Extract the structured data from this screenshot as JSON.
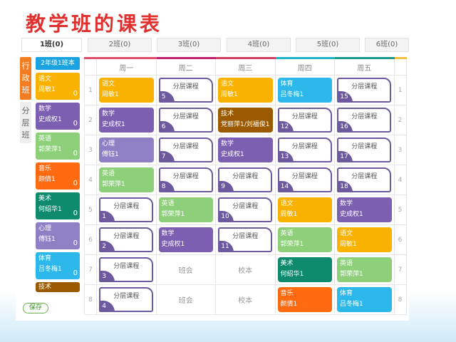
{
  "title": "教学班的课表",
  "class_tabs": [
    "1班(0)",
    "2班(0)",
    "3班(0)",
    "4班(0)",
    "5班(0)",
    "6班(0)"
  ],
  "vertical_tabs": [
    "行政班",
    "分层班"
  ],
  "side": {
    "header": "2年级1班本",
    "save_label": "保存",
    "items": [
      {
        "subject": "语文",
        "teacher": "周敏1",
        "count": "0",
        "color": "#f9b200"
      },
      {
        "subject": "数学",
        "teacher": "史成权1",
        "count": "0",
        "color": "#7b5fb0"
      },
      {
        "subject": "英语",
        "teacher": "郭荣萍1",
        "count": "0",
        "color": "#8ed07a"
      },
      {
        "subject": "音乐",
        "teacher": "颜倩1",
        "count": "0",
        "color": "#ff6a10"
      },
      {
        "subject": "美术",
        "teacher": "何绍华1",
        "count": "0",
        "color": "#0e8a6c"
      },
      {
        "subject": "心理",
        "teacher": "傅钰1",
        "count": "0",
        "color": "#8f7fc4"
      },
      {
        "subject": "体育",
        "teacher": "吕冬梅1",
        "count": "0",
        "color": "#2cb8ea"
      },
      {
        "subject": "技术",
        "teacher": "",
        "count": "",
        "color": "#9b5a00"
      }
    ]
  },
  "days": [
    "周一",
    "周二",
    "周三",
    "周四",
    "周五"
  ],
  "day_colors": [
    "#e04f6e",
    "#c0206a",
    "#d04060",
    "#1fb5c8",
    "#1a9a8a"
  ],
  "layer_label": "分层课程",
  "colors": {
    "语文": "#f9b200",
    "数学": "#7b5fb0",
    "英语": "#8ed07a",
    "音乐": "#ff6a10",
    "美术": "#0e8a6c",
    "心理": "#8f7fc4",
    "体育": "#2cb8ea",
    "技术": "#9b5a00"
  },
  "rows": [
    [
      {
        "s": "语文",
        "t": "周敏1"
      },
      {
        "layer": "5"
      },
      {
        "s": "语文",
        "t": "周敏1"
      },
      {
        "s": "体育",
        "t": "吕冬梅1"
      },
      {
        "layer": "15"
      }
    ],
    [
      {
        "s": "数学",
        "t": "史成权1"
      },
      {
        "layer": "6"
      },
      {
        "s": "技术",
        "t": "党丽萍1/刘福俊1"
      },
      {
        "layer": "12"
      },
      {
        "layer": "16"
      }
    ],
    [
      {
        "s": "心理",
        "t": "傅钰1"
      },
      {
        "layer": "7"
      },
      {
        "s": "数学",
        "t": "史成权1"
      },
      {
        "layer": "13"
      },
      {
        "layer": "17"
      }
    ],
    [
      {
        "s": "英语",
        "t": "郭荣萍1"
      },
      {
        "layer": "8"
      },
      {
        "layer": "9"
      },
      {
        "layer": "14"
      },
      {
        "layer": "18"
      }
    ],
    [
      {
        "layer": "1"
      },
      {
        "s": "英语",
        "t": "郭荣萍1"
      },
      {
        "layer": "10"
      },
      {
        "s": "语文",
        "t": "周敏1"
      },
      {
        "s": "数学",
        "t": "史成权1"
      }
    ],
    [
      {
        "layer": "2"
      },
      {
        "s": "数学",
        "t": "史成权1"
      },
      {
        "layer": "11"
      },
      {
        "s": "英语",
        "t": "郭荣萍1"
      },
      {
        "s": "语文",
        "t": "周敏1"
      }
    ],
    [
      {
        "layer": "3"
      },
      {
        "plain": "班会"
      },
      {
        "plain": "校本"
      },
      {
        "s": "美术",
        "t": "何绍华1"
      },
      {
        "s": "英语",
        "t": "郭荣萍1"
      }
    ],
    [
      {
        "layer": "4"
      },
      {
        "plain": "班会"
      },
      {
        "plain": "校本"
      },
      {
        "s": "音乐",
        "t": "颜倩1"
      },
      {
        "s": "体育",
        "t": "吕冬梅1"
      }
    ]
  ]
}
